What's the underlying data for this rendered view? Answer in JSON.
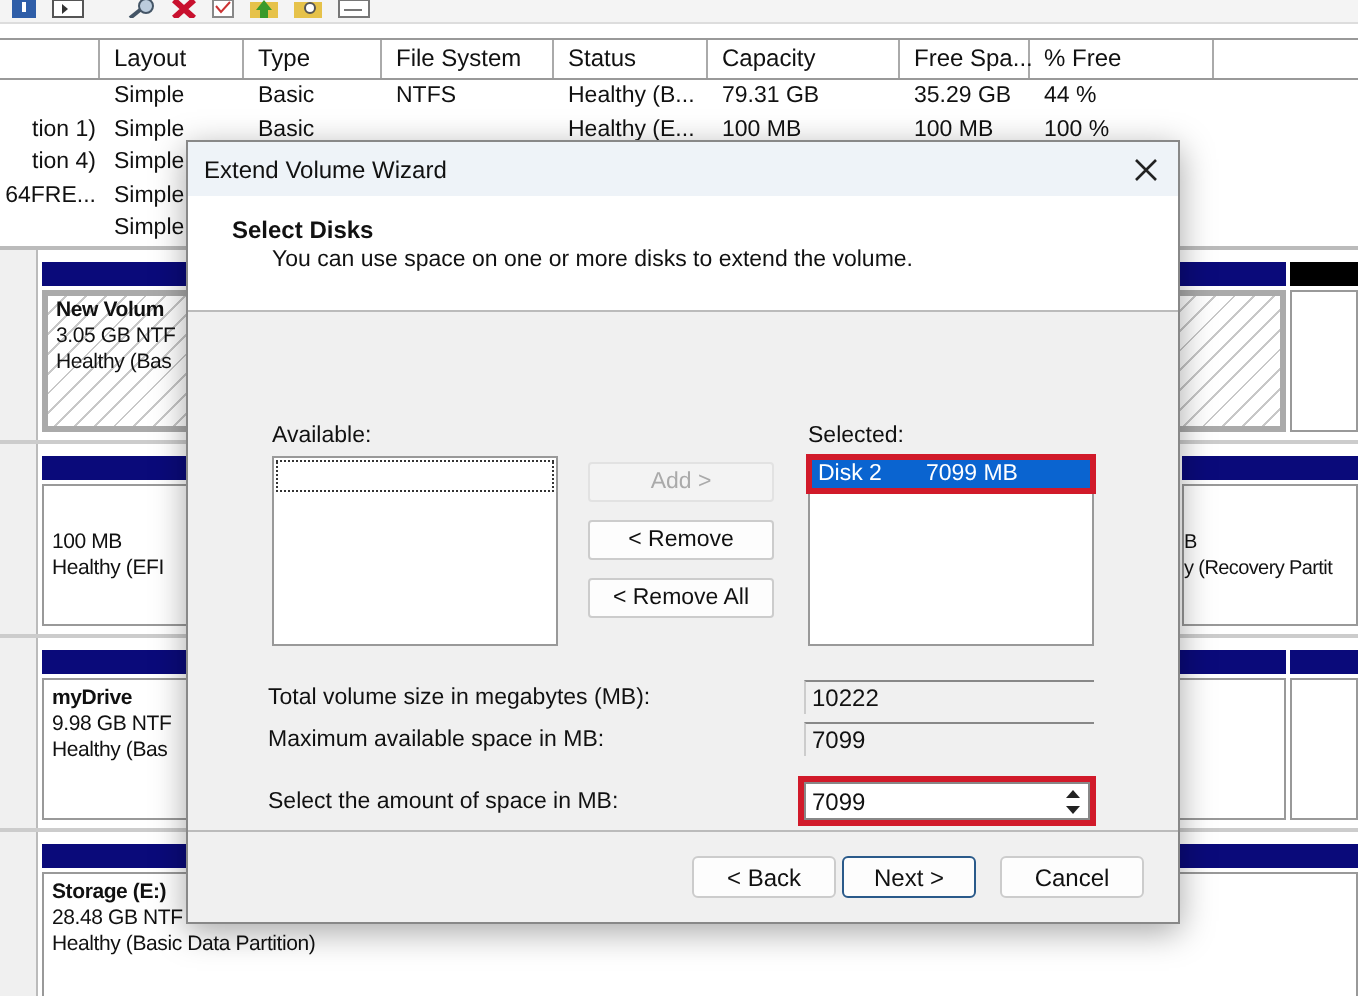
{
  "volume_table": {
    "columns": [
      "Layout",
      "Type",
      "File System",
      "Status",
      "Capacity",
      "Free Spa...",
      "% Free"
    ],
    "rows": [
      {
        "cells": [
          "Simple",
          "Basic",
          "NTFS",
          "Healthy (B...",
          "79.31 GB",
          "35.29 GB",
          "44 %"
        ]
      },
      {
        "column_1": "tion 1)",
        "cells": [
          "Simple",
          "Basic",
          null,
          "Healthy (E...",
          "100 MB",
          "100 MB",
          "100 %"
        ]
      },
      {
        "column_1": "tion 4)",
        "cells": [
          "Simple"
        ]
      },
      {
        "column_1": "64FRE...",
        "cells": [
          "Simple"
        ]
      },
      {
        "cells": [
          "Simple"
        ]
      }
    ]
  },
  "disk_map": {
    "disks": [
      {
        "partitions": [
          {
            "kind": "primary",
            "selected": true,
            "name": "New Volum",
            "size": "3.05 GB NTF",
            "status": "Healthy (Bas"
          },
          {
            "kind": "unallocated",
            "selected": false
          }
        ]
      },
      {
        "partitions": [
          {
            "kind": "primary",
            "selected": false,
            "size": "100 MB",
            "status": "Healthy (EFI"
          },
          {
            "kind": "primary",
            "selected": false,
            "size": "B",
            "status": "y (Recovery Partit"
          }
        ]
      },
      {
        "partitions": [
          {
            "kind": "primary",
            "selected": false,
            "name": "myDrive",
            "size": "9.98 GB NTF",
            "status": "Healthy (Bas"
          },
          {
            "kind": "primary",
            "selected": false
          }
        ]
      },
      {
        "partitions": [
          {
            "kind": "primary",
            "selected": false,
            "name": "Storage (E:)",
            "size": "28.48 GB NTF",
            "status": "Healthy (Basic Data Partition)"
          }
        ]
      }
    ]
  },
  "dialog": {
    "title": "Extend Volume Wizard",
    "heading": "Select Disks",
    "subtitle": "You can use space on one or more disks to extend the volume.",
    "available": {
      "label": "Available:"
    },
    "move_buttons": [
      {
        "label": "Add >",
        "disabled": true
      },
      {
        "label": "< Remove",
        "disabled": false
      },
      {
        "label": "< Remove All",
        "disabled": false
      }
    ],
    "selected": {
      "label": "Selected:",
      "items": [
        {
          "disk": "Disk 2",
          "size": "7099 MB",
          "selected": true,
          "highlighted": true
        }
      ]
    },
    "fields": [
      {
        "kind": "readonly",
        "label": "Total volume size in megabytes (MB):",
        "value": "10222",
        "highlighted": false
      },
      {
        "kind": "readonly",
        "label": "Maximum available space in MB:",
        "value": "7099",
        "highlighted": false
      },
      {
        "kind": "spinner",
        "label": "Select the amount of space in MB:",
        "value": "7099",
        "highlighted": true
      }
    ],
    "buttons": [
      {
        "label": "< Back",
        "default": false
      },
      {
        "label": "Next >",
        "default": true
      },
      {
        "label": "Cancel",
        "default": false
      }
    ]
  }
}
